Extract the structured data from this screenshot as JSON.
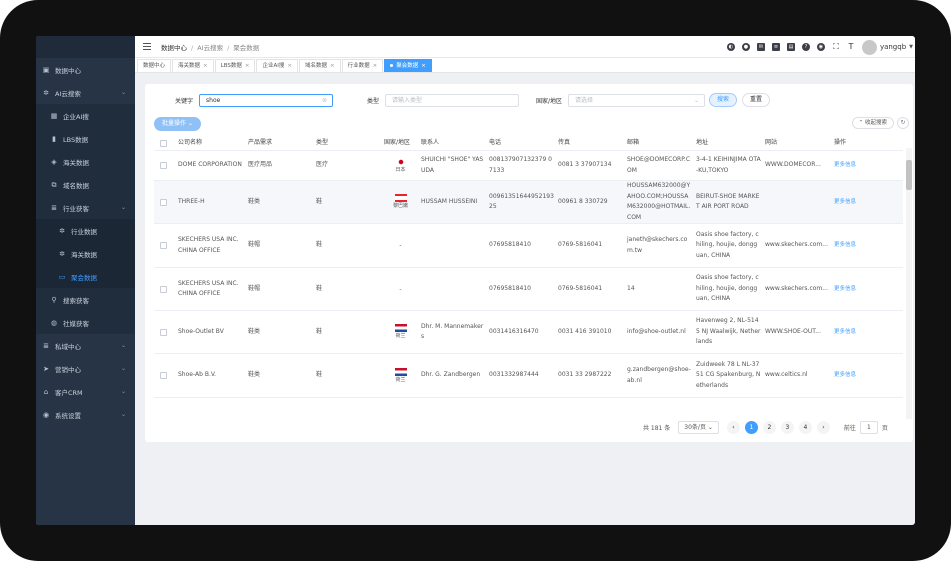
{
  "header": {
    "breadcrumb": [
      "数据中心",
      "AI云搜索",
      "聚会数据"
    ],
    "username": "yangqb",
    "icons": [
      "pie-icon",
      "chat-icon",
      "mail-icon",
      "doc-icon",
      "print-icon",
      "help-icon",
      "github-icon",
      "fullscreen-icon",
      "font-size-icon"
    ]
  },
  "tabs": [
    {
      "label": "数据中心",
      "active": false,
      "closable": false
    },
    {
      "label": "海关数据",
      "active": false,
      "closable": true
    },
    {
      "label": "LBS数据",
      "active": false,
      "closable": true
    },
    {
      "label": "企业AI搜",
      "active": false,
      "closable": true
    },
    {
      "label": "域名数据",
      "active": false,
      "closable": true
    },
    {
      "label": "行业数据",
      "active": false,
      "closable": true
    },
    {
      "label": "聚会数据",
      "active": true,
      "closable": true
    }
  ],
  "sidebar": {
    "items": [
      {
        "label": "数据中心",
        "icon": "dashboard-icon",
        "level": 0,
        "chevron": false
      },
      {
        "label": "AI云搜索",
        "icon": "gear-icon",
        "level": 0,
        "chevron": true
      },
      {
        "label": "企业AI搜",
        "icon": "building-icon",
        "level": 1,
        "chevron": false
      },
      {
        "label": "LBS数据",
        "icon": "map-icon",
        "level": 1,
        "chevron": false
      },
      {
        "label": "海关数据",
        "icon": "ship-icon",
        "level": 1,
        "chevron": false
      },
      {
        "label": "域名数据",
        "icon": "link-icon",
        "level": 1,
        "chevron": false
      },
      {
        "label": "行业获客",
        "icon": "list-icon",
        "level": 1,
        "chevron": true
      },
      {
        "label": "行业数据",
        "icon": "gear-icon",
        "level": 2,
        "chevron": false
      },
      {
        "label": "海关数据",
        "icon": "gear-icon",
        "level": 2,
        "chevron": false
      },
      {
        "label": "聚会数据",
        "icon": "chat-icon",
        "level": 2,
        "chevron": false,
        "active": true
      },
      {
        "label": "搜索获客",
        "icon": "search-icon",
        "level": 1,
        "chevron": false
      },
      {
        "label": "社媒获客",
        "icon": "globe-icon",
        "level": 1,
        "chevron": false
      },
      {
        "label": "私域中心",
        "icon": "list-icon",
        "level": 0,
        "chevron": true
      },
      {
        "label": "营销中心",
        "icon": "send-icon",
        "level": 0,
        "chevron": true
      },
      {
        "label": "客户CRM",
        "icon": "crm-icon",
        "level": 0,
        "chevron": true
      },
      {
        "label": "系统设置",
        "icon": "settings-icon",
        "level": 0,
        "chevron": true
      }
    ]
  },
  "filters": {
    "keyword_label": "关键字",
    "keyword_value": "shoe",
    "category_label": "类型",
    "category_placeholder": "请输入类型",
    "country_label": "国家/地区",
    "country_placeholder": "请选择",
    "search_button": "搜索",
    "reset_button": "重置",
    "batch_button": "批量操作",
    "collapse_button": "收起搜索"
  },
  "table": {
    "columns": [
      "公司名称",
      "产品需求",
      "类型",
      "国家/地区",
      "联系人",
      "电话",
      "传真",
      "邮箱",
      "地址",
      "网站",
      "操作"
    ],
    "rows": [
      {
        "company": "DOME CORPORATION",
        "product": "医疗用品",
        "type": "医疗",
        "country": "日本",
        "flag": "jp",
        "contact": "SHUICHI \"SHOE\" YASUDA",
        "phone": "008137907132379 07133",
        "fax": "0081 3 37907134",
        "email": "SHOE@DOMECORP.COM",
        "address": "3-4-1 KEIHINJIMA OTA-KU,TOKYO",
        "website": "WWW.DOMECOR...",
        "action": "更多信息"
      },
      {
        "company": "THREE-H",
        "product": "鞋类",
        "type": "鞋",
        "country": "黎巴嫩",
        "flag": "lb",
        "contact": "HUSSAM HUSSEINI",
        "phone": "00961351644952193 25",
        "fax": "00961 8 330729",
        "email": "HOUSSAM632000@YAHOO.COM;HOUSSAM632000@HOTMAIL.COM",
        "address": "BEIRUT-SHOE MARKET AIR PORT ROAD",
        "website": "",
        "action": "更多信息"
      },
      {
        "company": "SKECHERS USA INC. CHINA OFFICE",
        "product": "鞋帽",
        "type": "鞋",
        "country": "-",
        "flag": "",
        "contact": "",
        "phone": "07695818410",
        "fax": "0769-5816041",
        "email": "janeth@skechers.com.tw",
        "address": "Oasis shoe factory, chiling, houjie, dongguan, CHINA",
        "website": "www.skechers.com...",
        "action": "更多信息"
      },
      {
        "company": "SKECHERS USA INC. CHINA OFFICE",
        "product": "鞋帽",
        "type": "鞋",
        "country": "-",
        "flag": "",
        "contact": "",
        "phone": "07695818410",
        "fax": "0769-5816041",
        "email": "14",
        "address": "Oasis shoe factory, chiling, houjie, dongguan, CHINA",
        "website": "www.skechers.com...",
        "action": "更多信息"
      },
      {
        "company": "Shoe-Outlet BV",
        "product": "鞋类",
        "type": "鞋",
        "country": "荷兰",
        "flag": "nl",
        "contact": "Dhr. M. Mannemakers",
        "phone": "0031416316470",
        "fax": "0031 416 391010",
        "email": "info@shoe-outlet.nl",
        "address": "Havenweg 2, NL-5145 NJ Waalwijk, Netherlands",
        "website": "WWW.SHOE-OUT...",
        "action": "更多信息"
      },
      {
        "company": "Shoe-Ab B.V.",
        "product": "鞋类",
        "type": "鞋",
        "country": "荷兰",
        "flag": "nl",
        "contact": "Dhr. G. Zandbergen",
        "phone": "0031332987444",
        "fax": "0031 33 2987222",
        "email": "g.zandbergen@shoe-ab.nl",
        "address": "Zuidweek 78 L NL-3751 CG Spakenburg, Netherlands",
        "website": "www.celtics.nl",
        "action": "更多信息"
      }
    ]
  },
  "pagination": {
    "total_text": "共 181 条",
    "page_size": "30条/页",
    "pages": [
      "1",
      "2",
      "3",
      "4"
    ],
    "current_page": "1",
    "goto_label": "前往",
    "goto_value": "1",
    "page_unit": "页"
  },
  "colors": {
    "primary": "#409eff",
    "sidebar_bg": "#263445",
    "device_frame": "#111111"
  }
}
